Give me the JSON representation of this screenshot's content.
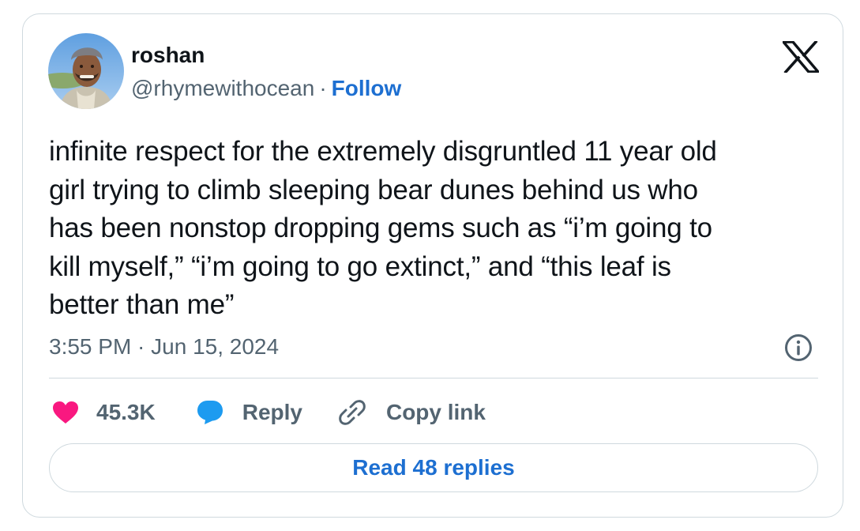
{
  "author": {
    "display_name": "roshan",
    "handle": "@rhymewithocean",
    "separator": "·",
    "follow_label": "Follow"
  },
  "tweet": {
    "lines": [
      "infinite respect for the extremely disgruntled 11 year old",
      "girl trying to climb sleeping bear dunes behind us who",
      "has been nonstop dropping gems such as “i’m going to",
      "kill myself,” “i’m going to go extinct,” and “this leaf is",
      "better than me”"
    ],
    "timestamp": "3:55 PM · Jun 15, 2024"
  },
  "actions": {
    "like_count": "45.3K",
    "reply_label": "Reply",
    "copy_link_label": "Copy link"
  },
  "read_replies_label": "Read 48 replies",
  "icons": {
    "brand_logo": "x-logo-icon",
    "info": "info-icon",
    "like": "heart-icon",
    "reply": "speech-bubble-icon",
    "copy_link": "link-icon"
  },
  "colors": {
    "accent": "#1d6fd1",
    "like": "#f91880",
    "muted_text": "#536471",
    "primary_text": "#0f1419",
    "border": "#cfd9de"
  }
}
